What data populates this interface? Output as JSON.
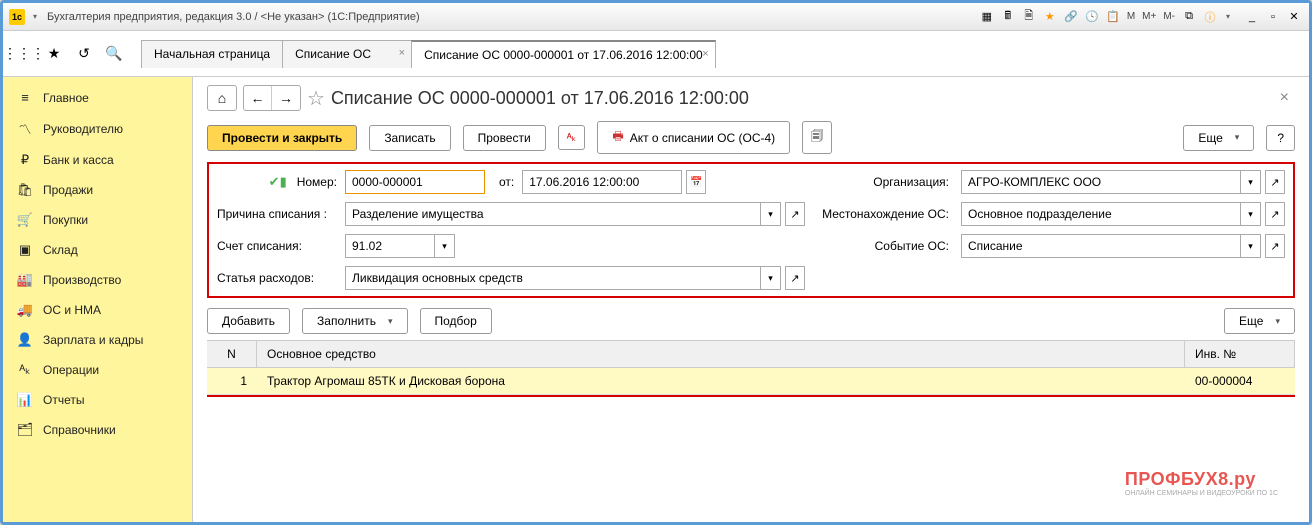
{
  "window": {
    "title": "Бухгалтерия предприятия, редакция 3.0 / <Не указан>   (1С:Предприятие)"
  },
  "tb_m": {
    "m": "M",
    "mp": "M+",
    "mm": "M-"
  },
  "tabs": {
    "t0": "Начальная страница",
    "t1": "Списание ОС",
    "t2": "Списание ОС 0000-000001 от 17.06.2016 12:00:00"
  },
  "sidebar": {
    "i0": "Главное",
    "i1": "Руководителю",
    "i2": "Банк и касса",
    "i3": "Продажи",
    "i4": "Покупки",
    "i5": "Склад",
    "i6": "Производство",
    "i7": "ОС и НМА",
    "i8": "Зарплата и кадры",
    "i9": "Операции",
    "i10": "Отчеты",
    "i11": "Справочники"
  },
  "header": {
    "title": "Списание ОС 0000-000001 от 17.06.2016 12:00:00"
  },
  "actions": {
    "post_close": "Провести и закрыть",
    "save": "Записать",
    "post": "Провести",
    "act": "Акт о списании ОС (ОС-4)",
    "more": "Еще",
    "help": "?"
  },
  "labels": {
    "number": "Номер:",
    "from": "от:",
    "org": "Организация:",
    "reason": "Причина списания :",
    "location": "Местонахождение ОС:",
    "account": "Счет списания:",
    "event": "Событие ОС:",
    "expense": "Статья расходов:"
  },
  "fields": {
    "number": "0000-000001",
    "date": "17.06.2016 12:00:00",
    "org": "АГРО-КОМПЛЕКС ООО",
    "reason": "Разделение имущества",
    "location": "Основное подразделение",
    "account": "91.02",
    "event": "Списание",
    "expense": "Ликвидация основных средств"
  },
  "list_actions": {
    "add": "Добавить",
    "fill": "Заполнить",
    "pick": "Подбор",
    "more": "Еще"
  },
  "table": {
    "h_n": "N",
    "h_os": "Основное средство",
    "h_inv": "Инв. №",
    "r1_n": "1",
    "r1_os": "Трактор Агромаш 85ТК и Дисковая борона",
    "r1_inv": "00-000004"
  },
  "watermark": {
    "main": "ПРОФБУХ8.ру",
    "sub": "ОНЛАЙН СЕМИНАРЫ И ВИДЕОУРОКИ ПО 1С"
  }
}
